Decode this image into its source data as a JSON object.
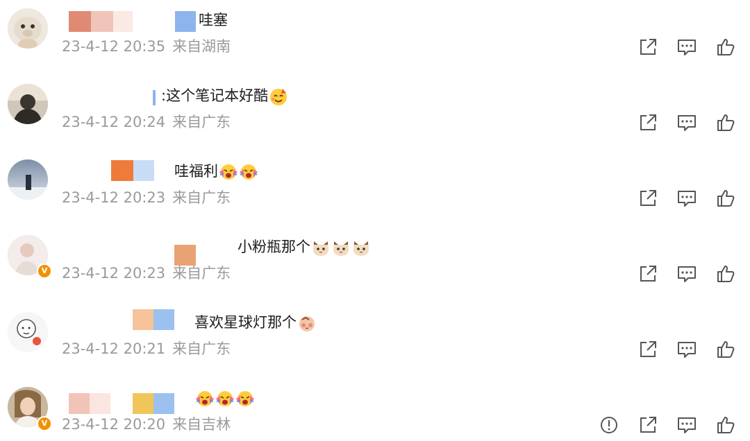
{
  "comments": [
    {
      "text": "哇塞",
      "date": "23-4-12 20:35",
      "location": "来自湖南",
      "emojis": [],
      "verified": false
    },
    {
      "text": ":这个笔记本好酷",
      "date": "23-4-12 20:24",
      "location": "来自广东",
      "emojis": [
        "party-face"
      ],
      "verified": false
    },
    {
      "text": "哇福利",
      "date": "23-4-12 20:23",
      "location": "来自广东",
      "emojis": [
        "cheer-face",
        "cheer-face"
      ],
      "verified": false
    },
    {
      "text": "小粉瓶那个",
      "date": "23-4-12 20:23",
      "location": "来自广东",
      "emojis": [
        "cat-face",
        "cat-face",
        "cat-face"
      ],
      "verified": true
    },
    {
      "text": "喜欢星球灯那个",
      "date": "23-4-12 20:21",
      "location": "来自广东",
      "emojis": [
        "shy-face"
      ],
      "verified": false
    },
    {
      "text": "",
      "date": "23-4-12 20:20",
      "location": "来自吉林",
      "emojis": [
        "cheer-face",
        "cheer-face",
        "cheer-face"
      ],
      "verified": true
    }
  ],
  "colors": {
    "text": "#1c1c1c",
    "meta": "#9a9a9a",
    "icon": "#555555",
    "verified_badge": "#f29100"
  },
  "icons": [
    "share-icon",
    "comment-icon",
    "like-icon",
    "report-icon"
  ]
}
